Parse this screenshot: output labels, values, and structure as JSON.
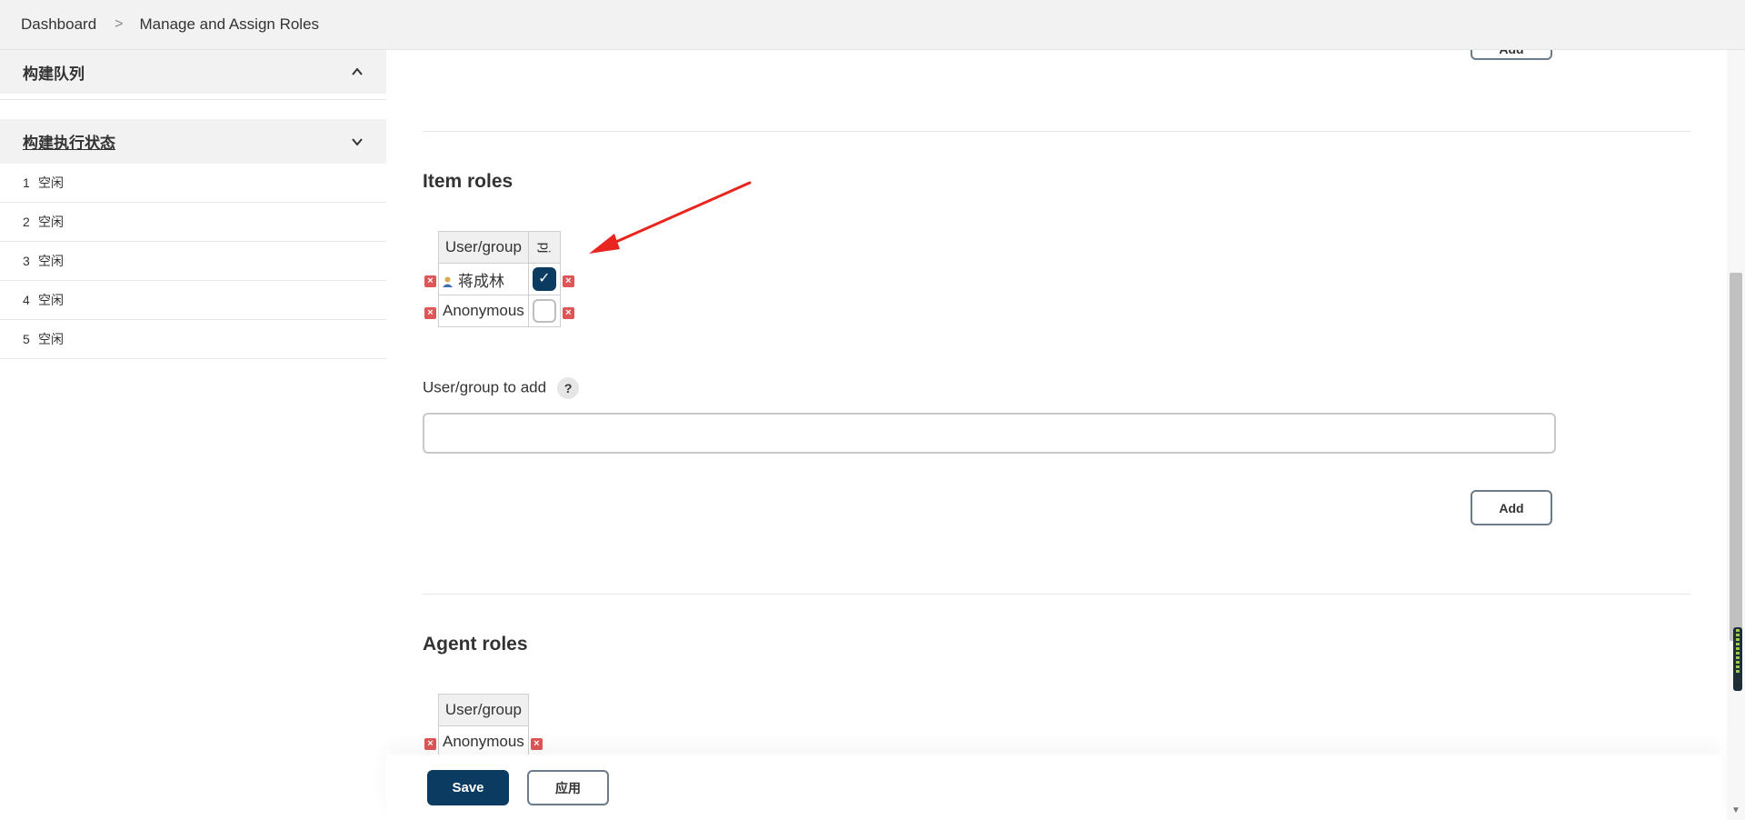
{
  "breadcrumb": {
    "items": [
      "Dashboard",
      "Manage and Assign Roles"
    ],
    "separator": ">"
  },
  "sidebar": {
    "build_queue": {
      "title": "构建队列"
    },
    "executor_status": {
      "title": "构建执行状态",
      "executors": [
        {
          "num": "1",
          "status": "空闲"
        },
        {
          "num": "2",
          "status": "空闲"
        },
        {
          "num": "3",
          "status": "空闲"
        },
        {
          "num": "4",
          "status": "空闲"
        },
        {
          "num": "5",
          "status": "空闲"
        }
      ]
    }
  },
  "main": {
    "top_add_button": "Add",
    "item_roles": {
      "title": "Item roles",
      "header_user": "User/group",
      "header_role": "pj",
      "rows": [
        {
          "user": "蒋成林",
          "checked": true
        },
        {
          "user": "Anonymous",
          "checked": false
        }
      ],
      "add_label": "User/group to add",
      "help": "?",
      "add_button": "Add"
    },
    "agent_roles": {
      "title": "Agent roles",
      "header_user": "User/group",
      "rows": [
        {
          "user": "Anonymous"
        }
      ]
    }
  },
  "bottom": {
    "save": "Save",
    "apply": "应用"
  },
  "colors": {
    "primary": "#0c3b62",
    "delete": "#e05555",
    "annotation_arrow": "#e8251e"
  }
}
